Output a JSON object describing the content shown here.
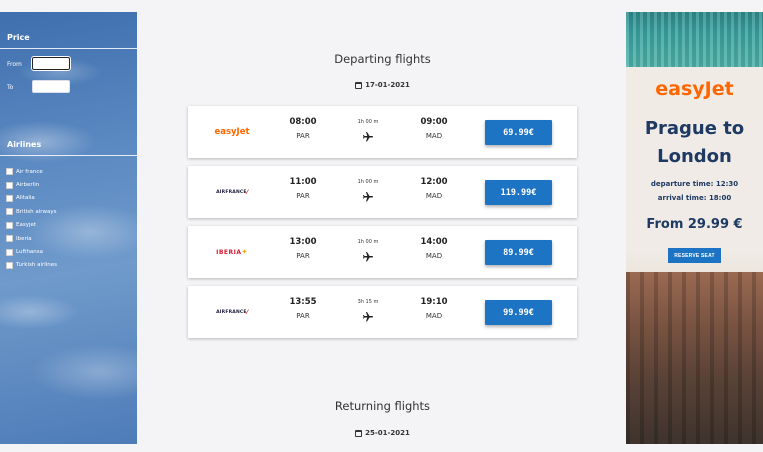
{
  "sidebar": {
    "price_heading": "Price",
    "from_label": "From",
    "to_label": "To",
    "airlines_heading": "Airlines",
    "airlines": [
      {
        "label": "Air france"
      },
      {
        "label": "Airberlin"
      },
      {
        "label": "Alitalia"
      },
      {
        "label": "British airways"
      },
      {
        "label": "Easyjet"
      },
      {
        "label": "Iberia"
      },
      {
        "label": "Lufthansa"
      },
      {
        "label": "Turkish airlines"
      }
    ]
  },
  "departing": {
    "title": "Departing flights",
    "date": "17-01-2021",
    "flights": [
      {
        "airline_logo_text": "easyJet",
        "dep_time": "08:00",
        "dep_code": "PAR",
        "duration": "1h 00 m",
        "arr_time": "09:00",
        "arr_code": "MAD",
        "price": "69.99€"
      },
      {
        "airline_logo_text": "AIRFRANCE",
        "dep_time": "11:00",
        "dep_code": "PAR",
        "duration": "1h 00 m",
        "arr_time": "12:00",
        "arr_code": "MAD",
        "price": "119.99€"
      },
      {
        "airline_logo_text": "IBERIA",
        "dep_time": "13:00",
        "dep_code": "PAR",
        "duration": "1h 00 m",
        "arr_time": "14:00",
        "arr_code": "MAD",
        "price": "89.99€"
      },
      {
        "airline_logo_text": "AIRFRANCE",
        "dep_time": "13:55",
        "dep_code": "PAR",
        "duration": "3h 15 m",
        "arr_time": "19:10",
        "arr_code": "MAD",
        "price": "99.99€"
      }
    ]
  },
  "returning": {
    "title": "Returning flights",
    "date": "25-01-2021"
  },
  "ad": {
    "brand": "easyJet",
    "headline_line1": "Prague to",
    "headline_line2": "London",
    "departure_time": "departure time: 12:30",
    "arrival_time": "arrival time: 18:00",
    "price": "From 29.99 €",
    "cta": "RESERVE SEAT"
  },
  "colors": {
    "accent": "#1d74c5",
    "easyjet_orange": "#ff6600",
    "ad_text": "#1e3a63"
  },
  "icons": {
    "calendar": "calendar-icon",
    "plane": "plane-icon"
  }
}
